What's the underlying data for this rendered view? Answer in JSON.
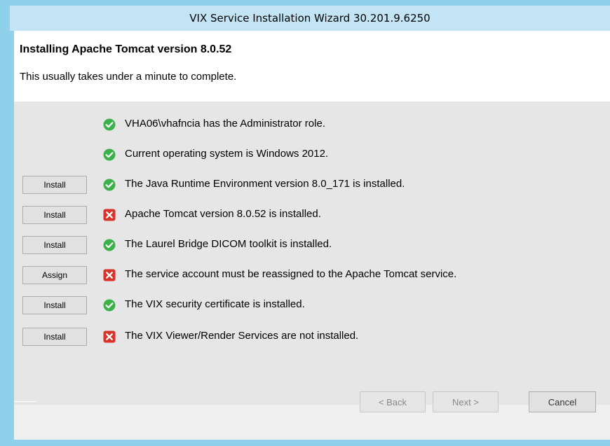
{
  "window": {
    "title": "VIX Service Installation Wizard 30.201.9.6250"
  },
  "header": {
    "title": "Installing Apache Tomcat version 8.0.52",
    "subtitle": "This usually takes under a minute to complete."
  },
  "checks": [
    {
      "button": null,
      "status": "ok",
      "icon": "check-circle-icon",
      "text": "VHA06\\vhafncia has the Administrator role."
    },
    {
      "button": null,
      "status": "ok",
      "icon": "check-circle-icon",
      "text": "Current operating system is Windows 2012."
    },
    {
      "button": "Install",
      "status": "ok",
      "icon": "check-circle-icon",
      "text": "The Java Runtime Environment version 8.0_171 is installed."
    },
    {
      "button": "Install",
      "status": "error",
      "icon": "error-x-icon",
      "text": "Apache Tomcat version 8.0.52 is installed."
    },
    {
      "button": "Install",
      "status": "ok",
      "icon": "check-circle-icon",
      "text": "The Laurel Bridge DICOM toolkit is installed."
    },
    {
      "button": "Assign",
      "status": "error",
      "icon": "error-x-icon",
      "text": "The service account must be reassigned to the Apache Tomcat service."
    },
    {
      "button": "Install",
      "status": "ok",
      "icon": "check-circle-icon",
      "text": "The VIX security certificate is installed."
    },
    {
      "button": "Install",
      "status": "error",
      "icon": "error-x-icon",
      "text": "The VIX Viewer/Render Services are not installed."
    }
  ],
  "footer": {
    "back_label": "< Back",
    "next_label": "Next >",
    "cancel_label": "Cancel"
  },
  "colors": {
    "ok": "#3cb14a",
    "error": "#d9332a",
    "frame": "#8fd0ea",
    "titlebar": "#c3e4f4"
  }
}
